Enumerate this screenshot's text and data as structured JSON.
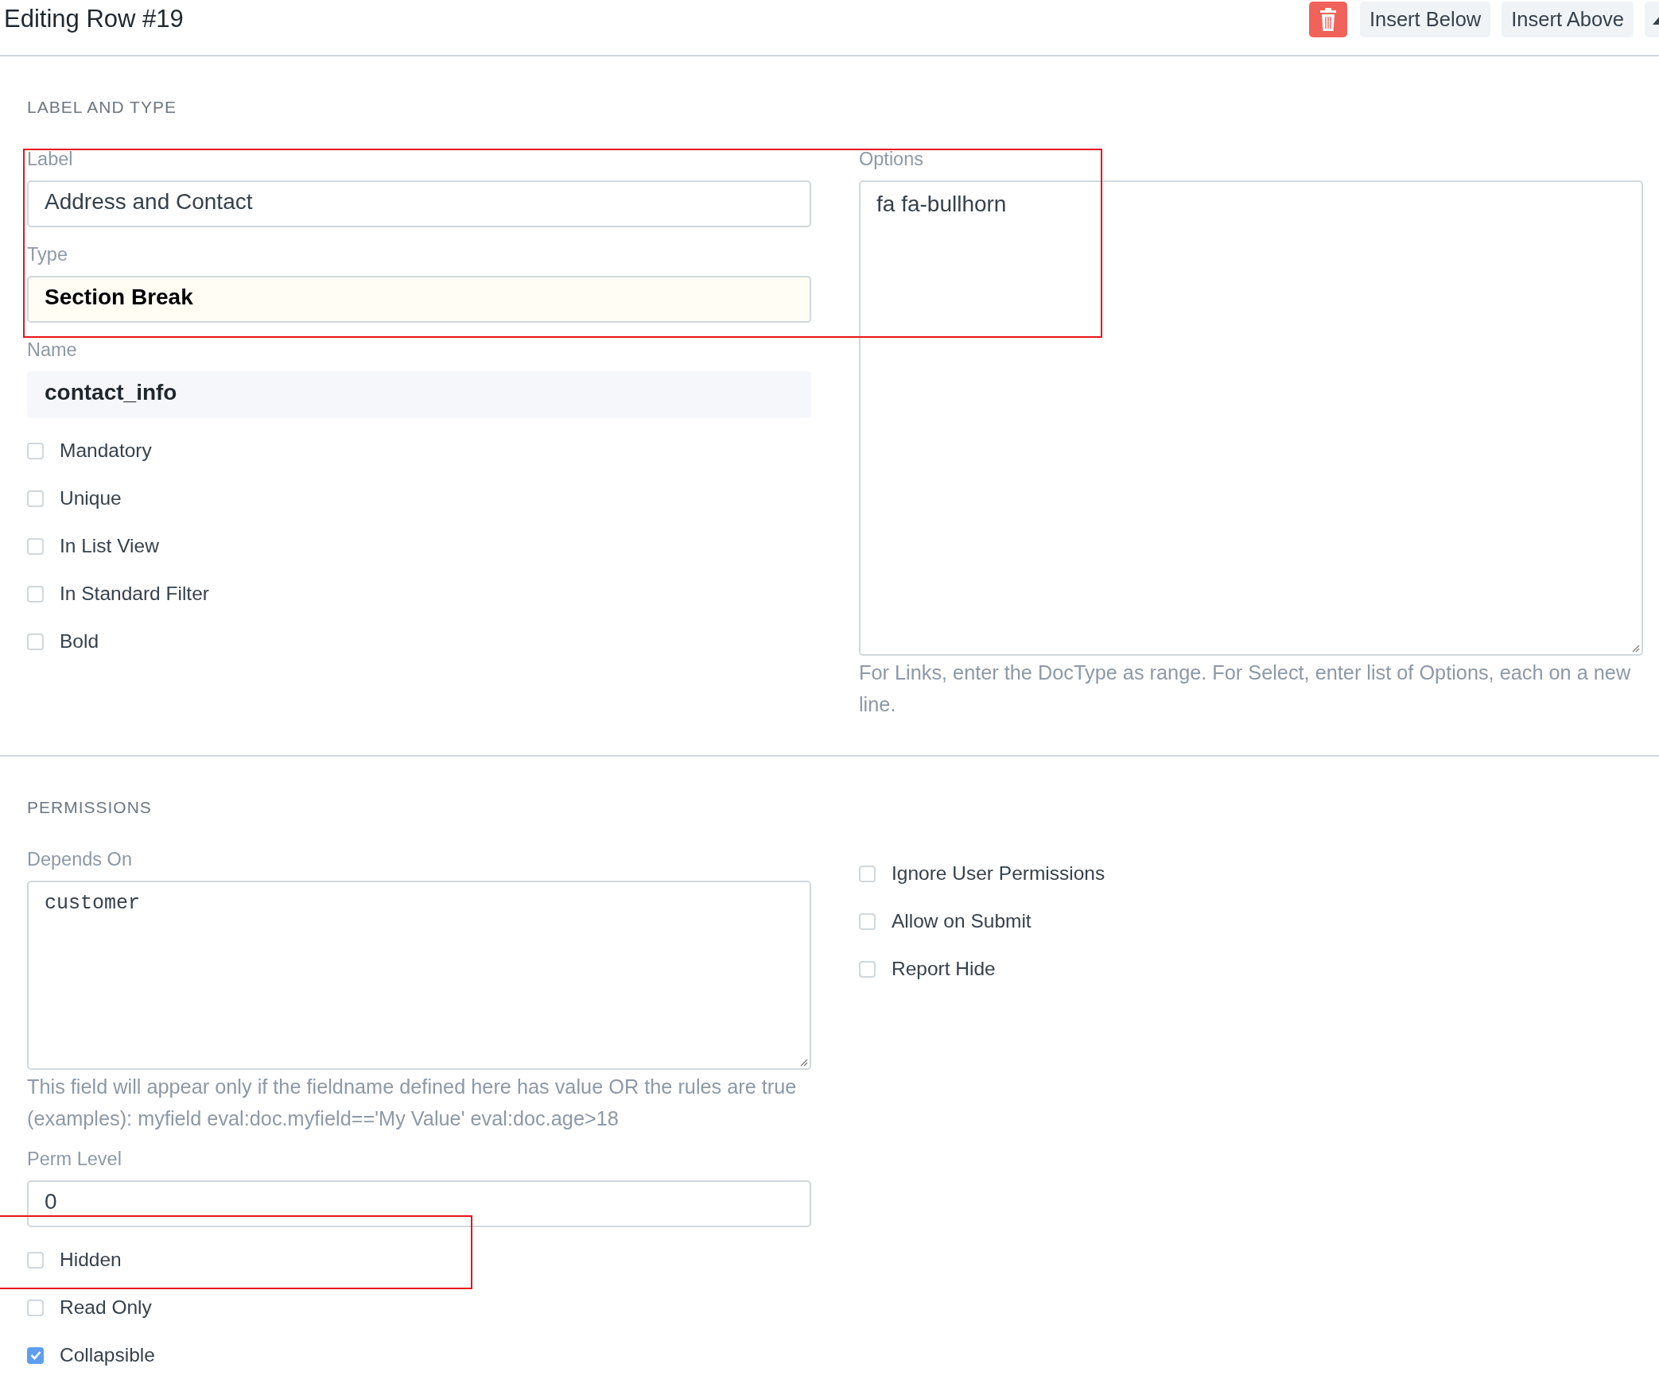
{
  "header": {
    "title": "Editing Row #19",
    "buttons": [
      {
        "kind": "delete"
      },
      {
        "kind": "text",
        "label": "Insert Below"
      },
      {
        "kind": "text",
        "label": "Insert Above"
      },
      {
        "kind": "collapse"
      }
    ]
  },
  "sections": [
    {
      "title": "LABEL AND TYPE",
      "left": [
        {
          "kind": "input",
          "label": "Label",
          "value": "Address and Contact"
        },
        {
          "kind": "select",
          "label": "Type",
          "value": "Section Break"
        },
        {
          "kind": "readonly",
          "label": "Name",
          "value": "contact_info"
        },
        {
          "kind": "check",
          "label": "Mandatory",
          "checked": false
        },
        {
          "kind": "check",
          "label": "Unique",
          "checked": false
        },
        {
          "kind": "check",
          "label": "In List View",
          "checked": false
        },
        {
          "kind": "check",
          "label": "In Standard Filter",
          "checked": false
        },
        {
          "kind": "check",
          "label": "Bold",
          "checked": false
        }
      ],
      "right": [
        {
          "kind": "textarea",
          "label": "Options",
          "value": "fa fa-bullhorn",
          "help": "For Links, enter the DocType as range. For Select, enter list of Options, each on a new line."
        }
      ]
    },
    {
      "title": "PERMISSIONS",
      "left": [
        {
          "kind": "code",
          "label": "Depends On",
          "value": "customer",
          "help": "This field will appear only if the fieldname defined here has value OR the rules are true (examples): myfield eval:doc.myfield=='My Value' eval:doc.age>18"
        },
        {
          "kind": "input",
          "label": "Perm Level",
          "value": "0"
        },
        {
          "kind": "check",
          "label": "Hidden",
          "checked": false
        },
        {
          "kind": "check",
          "label": "Read Only",
          "checked": false
        },
        {
          "kind": "check",
          "label": "Collapsible",
          "checked": true
        }
      ],
      "right": [
        {
          "kind": "check",
          "label": "Ignore User Permissions",
          "checked": false
        },
        {
          "kind": "check",
          "label": "Allow on Submit",
          "checked": false
        },
        {
          "kind": "check",
          "label": "Report Hide",
          "checked": false
        }
      ]
    }
  ]
}
